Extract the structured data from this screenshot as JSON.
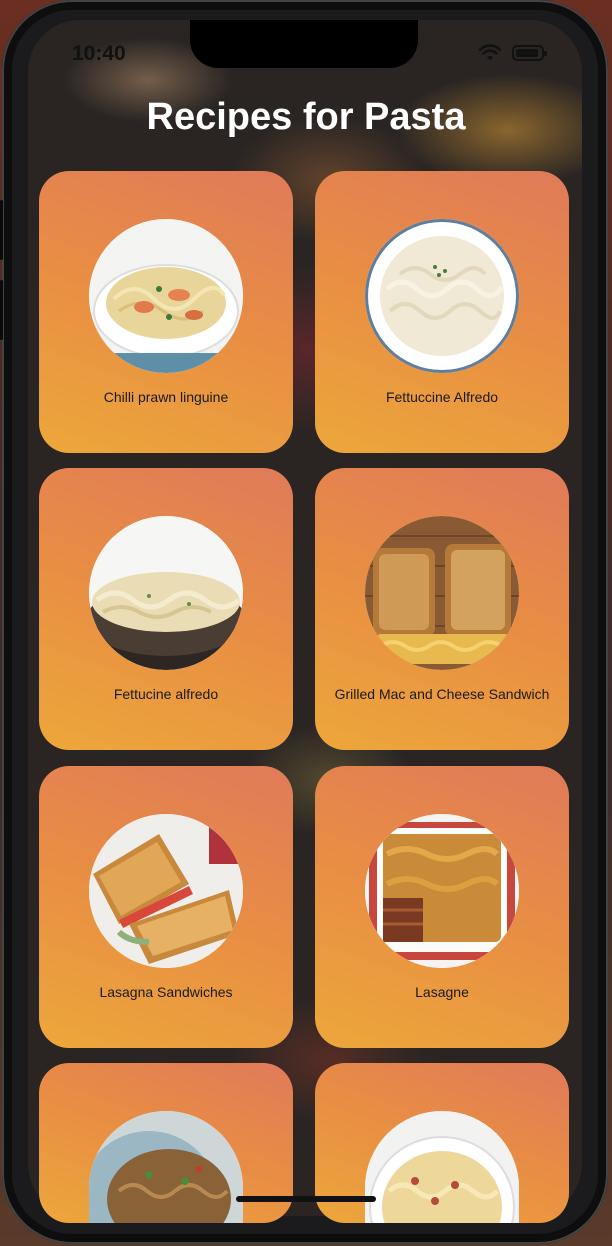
{
  "status_bar": {
    "time": "10:40"
  },
  "header": {
    "title": "Recipes for Pasta"
  },
  "recipes": [
    {
      "name": "Chilli prawn linguine"
    },
    {
      "name": "Fettuccine Alfredo"
    },
    {
      "name": "Fettucine alfredo"
    },
    {
      "name": "Grilled Mac and Cheese Sandwich"
    },
    {
      "name": "Lasagna Sandwiches"
    },
    {
      "name": "Lasagne"
    },
    {
      "name": ""
    },
    {
      "name": ""
    }
  ],
  "colors": {
    "card_top": "#e07a5a",
    "card_bottom": "#eda73a",
    "title": "#ffffff"
  }
}
